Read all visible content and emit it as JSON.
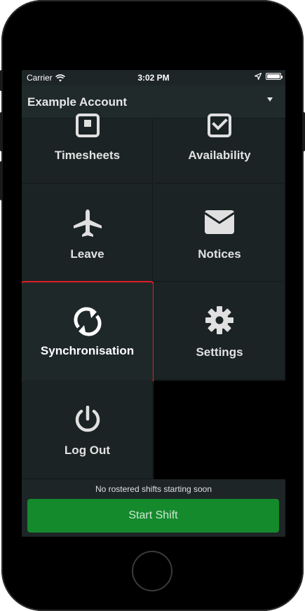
{
  "status_bar": {
    "carrier": "Carrier",
    "time": "3:02 PM"
  },
  "account": {
    "name": "Example Account"
  },
  "menu": {
    "timesheets": "Timesheets",
    "availability": "Availability",
    "leave": "Leave",
    "notices": "Notices",
    "synchronisation": "Synchronisation",
    "settings": "Settings",
    "log_out": "Log Out"
  },
  "footer": {
    "notice": "No rostered shifts starting soon",
    "start_shift": "Start Shift"
  },
  "colors": {
    "highlight_border": "#e01b24",
    "start_button": "#148a2c",
    "tile_background": "#1b2324"
  },
  "icons": {
    "timesheets": "timesheet-icon",
    "availability": "checkbox-icon",
    "leave": "airplane-icon",
    "notices": "envelope-icon",
    "synchronisation": "sync-icon",
    "settings": "gear-icon",
    "log_out": "power-icon"
  }
}
